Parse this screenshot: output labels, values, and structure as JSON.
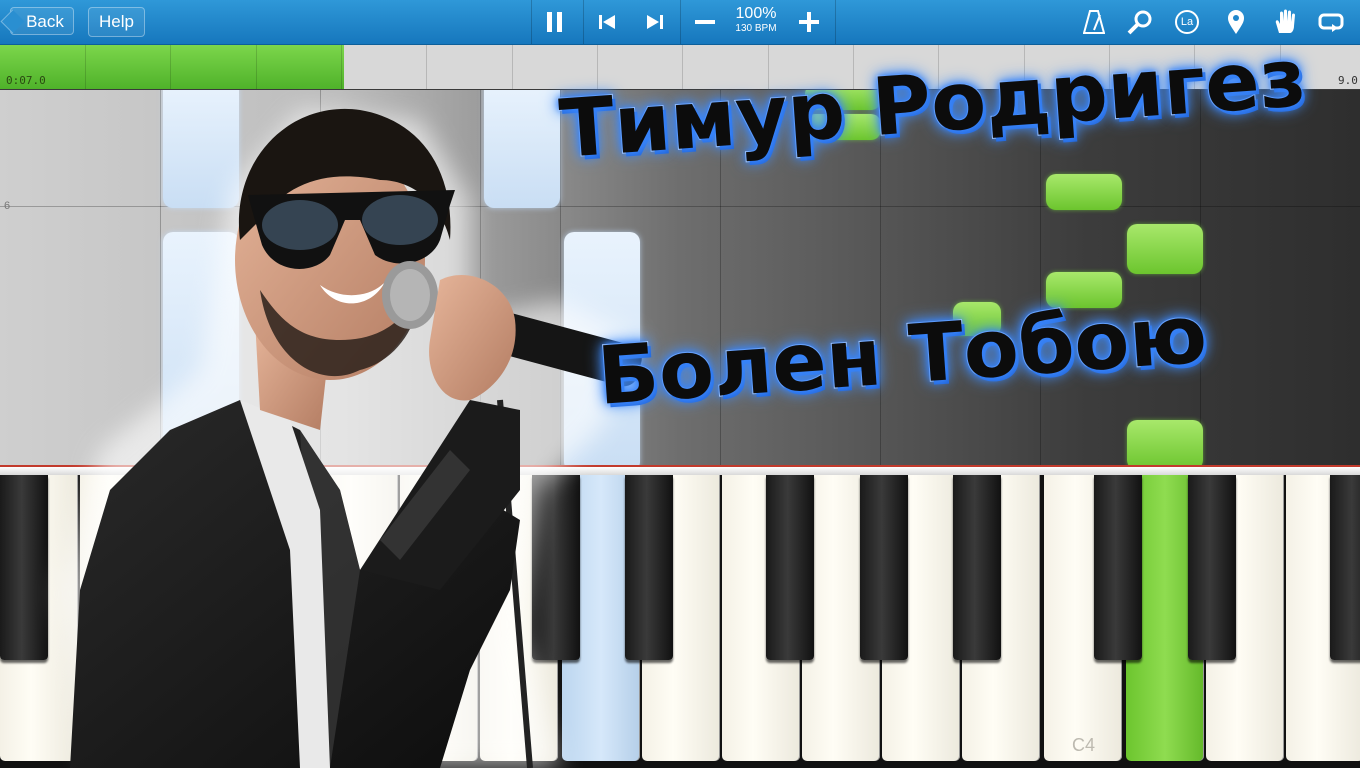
{
  "toolbar": {
    "back_label": "Back",
    "help_label": "Help",
    "speed_percent": "100%",
    "tempo": "130 BPM",
    "icons": [
      "pause-icon",
      "skip-back-icon",
      "skip-forward-icon",
      "minus-icon",
      "plus-icon",
      "metronome-icon",
      "search-icon",
      "note-label-icon",
      "location-pin-icon",
      "hand-icon",
      "loop-icon"
    ],
    "note_label_badge": "La"
  },
  "timeline": {
    "elapsed": "0:07.0",
    "end_time": "9.0",
    "progress_fraction": 0.253
  },
  "lanes": {
    "measure_number": "6"
  },
  "keyboard": {
    "middle_c_label": "C4"
  },
  "overlay": {
    "artist": "Тимур Родригез",
    "song": "Болен Тобою"
  },
  "colors": {
    "toolbar": "#1f87cc",
    "progress": "#5cbc32",
    "left_hand": "#cfe2f6",
    "right_hand": "#7ccf3c",
    "title_glow": "#2e7cf6"
  }
}
